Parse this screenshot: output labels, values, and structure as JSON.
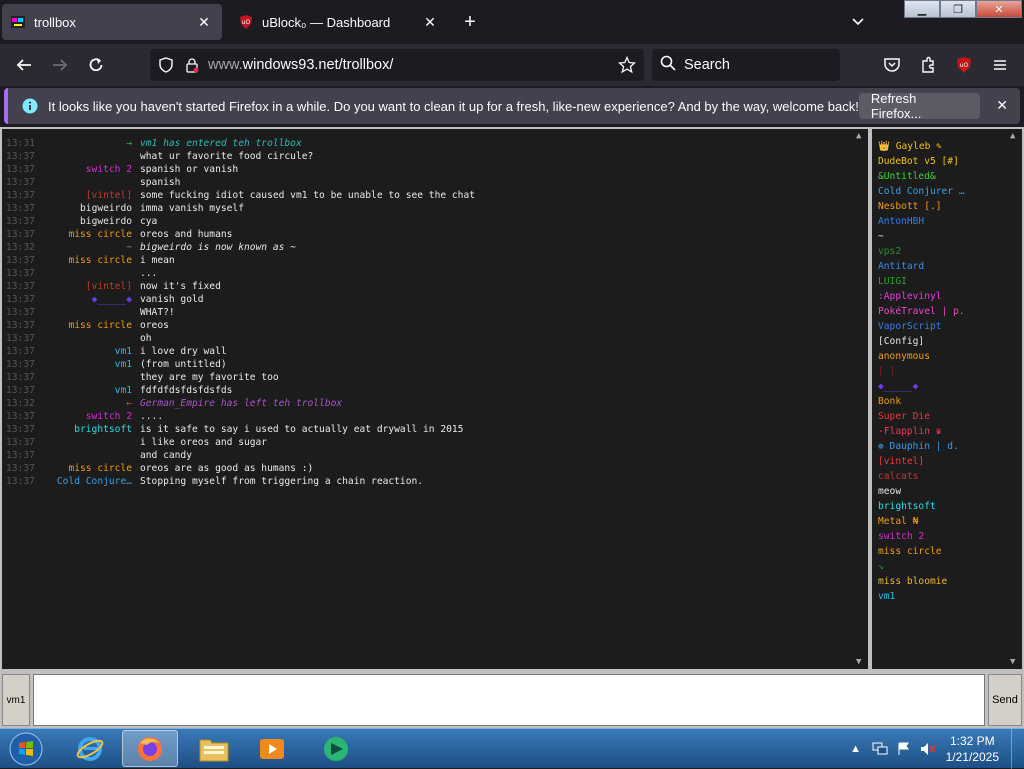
{
  "browser": {
    "tabs": [
      {
        "title": "trollbox",
        "active": true
      },
      {
        "title": "uBlock₀ — Dashboard",
        "active": false
      }
    ],
    "url_prefix": "www.",
    "url_main": "windows93.net/trollbox/",
    "search_placeholder": "Search"
  },
  "notification": {
    "message": "It looks like you haven't started Firefox in a while. Do you want to clean it up for a fresh, like-new experience? And by the way, welcome back!",
    "button": "Refresh Firefox..."
  },
  "chat": {
    "messages": [
      {
        "time": "13:31",
        "nick": "→",
        "nick_color": "#3cbd3c",
        "text": "vm1 has entered teh trollbox",
        "italic": true,
        "text_color": "#2fb8b8"
      },
      {
        "time": "13:37",
        "nick": "",
        "nick_color": "#888",
        "text": "what ur favorite food circule?",
        "italic": false
      },
      {
        "time": "13:37",
        "nick": "switch 2",
        "nick_color": "#d12fd1",
        "text": "spanish or vanish",
        "italic": false
      },
      {
        "time": "13:37",
        "nick": "",
        "nick_color": "#888",
        "text": "spanish",
        "italic": false
      },
      {
        "time": "13:37",
        "nick": "[vintel]",
        "nick_color": "#c0392b",
        "text": "some fucking idiot caused vm1 to be unable to see the chat",
        "italic": false
      },
      {
        "time": "13:37",
        "nick": "bigweirdo",
        "nick_color": "#e6e6e6",
        "text": "imma vanish myself",
        "italic": false
      },
      {
        "time": "13:37",
        "nick": "bigweirdo",
        "nick_color": "#e6e6e6",
        "text": "cya",
        "italic": false
      },
      {
        "time": "13:37",
        "nick": "miss circle",
        "nick_color": "#f39c12",
        "text": "oreos and humans",
        "italic": false
      },
      {
        "time": "13:32",
        "nick": "~",
        "nick_color": "#888",
        "text": "bigweirdo is now known as ~",
        "italic": true
      },
      {
        "time": "13:37",
        "nick": "miss circle",
        "nick_color": "#f39c12",
        "text": "i mean",
        "italic": false
      },
      {
        "time": "13:37",
        "nick": "",
        "nick_color": "#888",
        "text": "...",
        "italic": false
      },
      {
        "time": "13:37",
        "nick": "[vintel]",
        "nick_color": "#c0392b",
        "text": "now it's fixed",
        "italic": false
      },
      {
        "time": "13:37",
        "nick": "◆_____◆",
        "nick_color": "#6a3de8",
        "text": "vanish gold",
        "italic": false
      },
      {
        "time": "13:37",
        "nick": "",
        "nick_color": "#888",
        "text": "WHAT?!",
        "italic": false
      },
      {
        "time": "13:37",
        "nick": "miss circle",
        "nick_color": "#f39c12",
        "text": "oreos",
        "italic": false
      },
      {
        "time": "13:37",
        "nick": "",
        "nick_color": "#888",
        "text": "oh",
        "italic": false
      },
      {
        "time": "13:37",
        "nick": "vm1",
        "nick_color": "#2fb8e8",
        "text": "i love dry wall",
        "italic": false
      },
      {
        "time": "13:37",
        "nick": "vm1",
        "nick_color": "#2fb8e8",
        "text": "(from untitled)",
        "italic": false
      },
      {
        "time": "13:37",
        "nick": "",
        "nick_color": "#888",
        "text": "they are my favorite too",
        "italic": false
      },
      {
        "time": "13:37",
        "nick": "vm1",
        "nick_color": "#2fb8e8",
        "text": "fdfdfdsfdsfdsfds",
        "italic": false
      },
      {
        "time": "13:32",
        "nick": "←",
        "nick_color": "#e74c3c",
        "text": "German_Empire has left teh trollbox",
        "italic": true,
        "text_color": "#a855c7"
      },
      {
        "time": "13:37",
        "nick": "switch 2",
        "nick_color": "#d12fd1",
        "text": " ....",
        "italic": false
      },
      {
        "time": "13:37",
        "nick": "brightsoft",
        "nick_color": "#2fd8e8",
        "text": "is it safe to say i used to actually eat drywall in 2015",
        "italic": false
      },
      {
        "time": "13:37",
        "nick": "",
        "nick_color": "#888",
        "text": "i like oreos and sugar",
        "italic": false
      },
      {
        "time": "13:37",
        "nick": "",
        "nick_color": "#888",
        "text": "and candy",
        "italic": false
      },
      {
        "time": "13:37",
        "nick": "miss circle",
        "nick_color": "#f39c12",
        "text": "oreos are as good as humans :)",
        "italic": false
      },
      {
        "time": "13:37",
        "nick": "Cold Conjure…",
        "nick_color": "#3aa0e8",
        "text": "Stopping myself from triggering a chain reaction.",
        "italic": false
      }
    ]
  },
  "users": [
    {
      "name": "👑 Gayleb ✎",
      "color": "#f1c40f"
    },
    {
      "name": "DudeBot v5 [#]",
      "color": "#f1c40f"
    },
    {
      "name": "&Untitled&",
      "color": "#3cd13c"
    },
    {
      "name": "Cold Conjurer …",
      "color": "#3aa0e8"
    },
    {
      "name": "Nesbott [.]",
      "color": "#f39c12"
    },
    {
      "name": "AntonHBH",
      "color": "#2f7de8"
    },
    {
      "name": "~",
      "color": "#e6e6e6"
    },
    {
      "name": "vps2",
      "color": "#2e8b2e"
    },
    {
      "name": "Antitard",
      "color": "#3a8ae8"
    },
    {
      "name": "LUIGI",
      "color": "#2e9e2e"
    },
    {
      "name": ":Applevinyl",
      "color": "#e83ae8"
    },
    {
      "name": "PokéTravel | p.",
      "color": "#e84ac8"
    },
    {
      "name": "VaporScript",
      "color": "#3a7ae8"
    },
    {
      "name": "[Config]",
      "color": "#e6e6e6"
    },
    {
      "name": "anonymous",
      "color": "#f39c12"
    },
    {
      "name": "[ ]",
      "color": "#8b1a1a"
    },
    {
      "name": "◆_____◆",
      "color": "#6a3de8"
    },
    {
      "name": "Bonk",
      "color": "#f39c12"
    },
    {
      "name": "Super Die",
      "color": "#e83a3a"
    },
    {
      "name": "-Flapplin ♛",
      "color": "#e83a5a"
    },
    {
      "name": "❁ Dauphin | d.",
      "color": "#3a9ae8"
    },
    {
      "name": "[vintel]",
      "color": "#e83a3a"
    },
    {
      "name": "calcats",
      "color": "#c0392b"
    },
    {
      "name": "meow",
      "color": "#e6e6e6"
    },
    {
      "name": "brightsoft",
      "color": "#2fd8e8"
    },
    {
      "name": "Metal ₦",
      "color": "#f39c12"
    },
    {
      "name": "switch 2",
      "color": "#d12fd1"
    },
    {
      "name": "miss circle",
      "color": "#f39c12"
    },
    {
      "name": "↘",
      "color": "#2e8b2e"
    },
    {
      "name": "miss bloomie",
      "color": "#e8b83a"
    },
    {
      "name": "vm1",
      "color": "#2fb8e8"
    }
  ],
  "input": {
    "nick": "vm1",
    "send": "Send",
    "value": ""
  },
  "taskbar": {
    "time": "1:32 PM",
    "date": "1/21/2025"
  }
}
